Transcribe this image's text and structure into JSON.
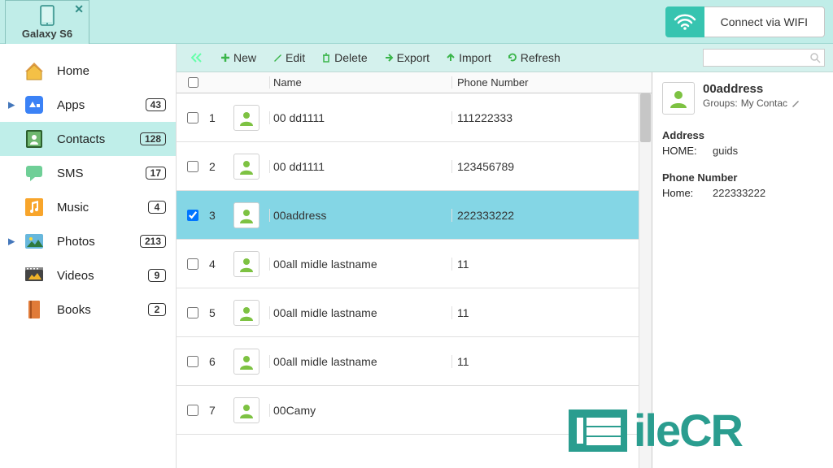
{
  "device": "Galaxy S6",
  "wifi_label": "Connect via WIFI",
  "sidebar": [
    {
      "key": "home",
      "label": "Home",
      "count": null,
      "expand": false,
      "active": false
    },
    {
      "key": "apps",
      "label": "Apps",
      "count": "43",
      "expand": true,
      "active": false
    },
    {
      "key": "contacts",
      "label": "Contacts",
      "count": "128",
      "expand": false,
      "active": true
    },
    {
      "key": "sms",
      "label": "SMS",
      "count": "17",
      "expand": false,
      "active": false
    },
    {
      "key": "music",
      "label": "Music",
      "count": "4",
      "expand": false,
      "active": false
    },
    {
      "key": "photos",
      "label": "Photos",
      "count": "213",
      "expand": true,
      "active": false
    },
    {
      "key": "videos",
      "label": "Videos",
      "count": "9",
      "expand": false,
      "active": false
    },
    {
      "key": "books",
      "label": "Books",
      "count": "2",
      "expand": false,
      "active": false
    }
  ],
  "toolbar": {
    "new": "New",
    "edit": "Edit",
    "delete": "Delete",
    "export": "Export",
    "import": "Import",
    "refresh": "Refresh"
  },
  "columns": {
    "name": "Name",
    "phone": "Phone Number"
  },
  "contacts": [
    {
      "idx": "1",
      "name": "00 dd1111",
      "phone": "111222333",
      "checked": false,
      "selected": false
    },
    {
      "idx": "2",
      "name": "00 dd1111",
      "phone": "123456789",
      "checked": false,
      "selected": false
    },
    {
      "idx": "3",
      "name": "00address",
      "phone": "222333222",
      "checked": true,
      "selected": true
    },
    {
      "idx": "4",
      "name": "00all midle lastname",
      "phone": "11",
      "checked": false,
      "selected": false
    },
    {
      "idx": "5",
      "name": "00all midle lastname",
      "phone": "11",
      "checked": false,
      "selected": false
    },
    {
      "idx": "6",
      "name": "00all midle lastname",
      "phone": "11",
      "checked": false,
      "selected": false
    },
    {
      "idx": "7",
      "name": "00Camy",
      "phone": "",
      "checked": false,
      "selected": false
    }
  ],
  "detail": {
    "name": "00address",
    "groups_label": "Groups:",
    "groups_value": "My Contac",
    "address_label": "Address",
    "address_type": "HOME:",
    "address_value": "guids",
    "phone_label": "Phone Number",
    "phone_type": "Home:",
    "phone_value": "222333222"
  },
  "watermark_text": "ileCR"
}
